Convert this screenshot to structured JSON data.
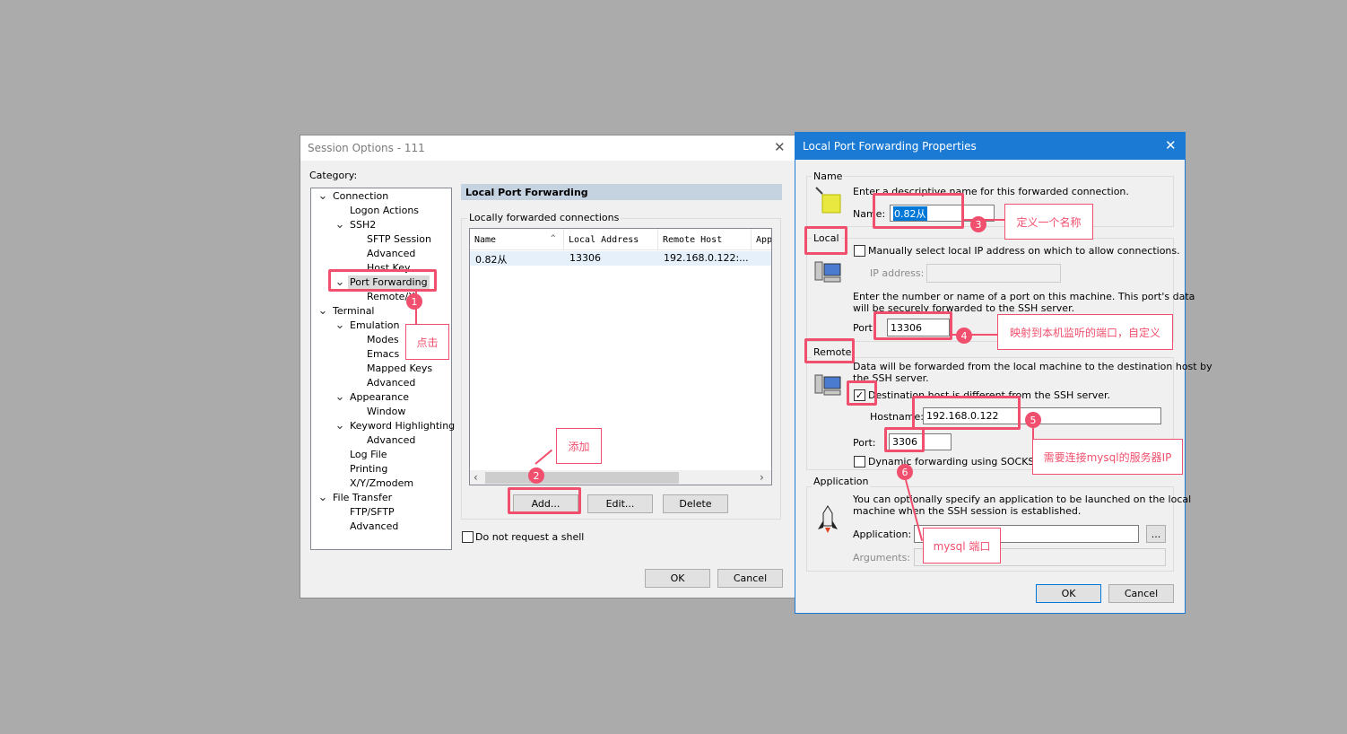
{
  "session": {
    "title": "Session Options - 111",
    "category_label": "Category:",
    "tree": [
      {
        "label": "Connection",
        "expanded": true
      },
      {
        "label": "Logon Actions"
      },
      {
        "label": "SSH2",
        "expanded": true
      },
      {
        "label": "SFTP Session"
      },
      {
        "label": "Advanced"
      },
      {
        "label": "Host Key"
      },
      {
        "label": "Port Forwarding",
        "expanded": true,
        "selected": true
      },
      {
        "label": "Remote/X"
      },
      {
        "label": "Terminal",
        "expanded": true
      },
      {
        "label": "Emulation",
        "expanded": true
      },
      {
        "label": "Modes"
      },
      {
        "label": "Emacs"
      },
      {
        "label": "Mapped Keys"
      },
      {
        "label": "Advanced"
      },
      {
        "label": "Appearance",
        "expanded": true
      },
      {
        "label": "Window"
      },
      {
        "label": "Keyword Highlighting",
        "expanded": true
      },
      {
        "label": "Advanced"
      },
      {
        "label": "Log File"
      },
      {
        "label": "Printing"
      },
      {
        "label": "X/Y/Zmodem"
      },
      {
        "label": "File Transfer",
        "expanded": true
      },
      {
        "label": "FTP/SFTP"
      },
      {
        "label": "Advanced"
      }
    ],
    "panel_header": "Local Port Forwarding",
    "group_label": "Locally forwarded connections",
    "columns": [
      "Name",
      "Local Address",
      "Remote Host",
      "App"
    ],
    "rows": [
      {
        "name": "0.82从",
        "local": "13306",
        "remote": "192.168.0.122:..."
      }
    ],
    "add_label": "Add...",
    "edit_label": "Edit...",
    "delete_label": "Delete",
    "no_shell_label": "Do not request a shell",
    "ok_label": "OK",
    "cancel_label": "Cancel"
  },
  "props": {
    "title": "Local Port Forwarding Properties",
    "name_group": "Name",
    "name_desc": "Enter a descriptive name for this forwarded connection.",
    "name_label": "Name:",
    "name_value": "0.82从",
    "local_group": "Local",
    "manual_ip_label": "Manually select local IP address on which to allow connections.",
    "ip_label": "IP address:",
    "local_desc1": "Enter the number or name of a port on this machine.  This port's data",
    "local_desc2": "will be securely forwarded to the SSH server.",
    "port_label": "Port:",
    "local_port": "13306",
    "remote_group": "Remote",
    "remote_desc1": "Data will be forwarded from the local machine to the destination host by",
    "remote_desc2": "the SSH server.",
    "dest_label": "Destination host is different from the SSH server.",
    "hostname_label": "Hostname:",
    "hostname": "192.168.0.122",
    "remote_port": "3306",
    "dynamic_label": "Dynamic forwarding using SOCKS 4 or 5",
    "app_group": "Application",
    "app_desc1": "You can optionally specify an application to be launched on the local",
    "app_desc2": "machine when the SSH session is established.",
    "app_label": "Application:",
    "browse_label": "...",
    "args_label": "Arguments:",
    "ok_label": "OK",
    "cancel_label": "Cancel"
  },
  "annotations": {
    "n1": "1",
    "t1": "点击",
    "n2": "2",
    "t2": "添加",
    "n3": "3",
    "t3": "定义一个名称",
    "n4": "4",
    "t4": "映射到本机监听的端口，自定义",
    "n5": "5",
    "t5": "需要连接mysql的服务器IP",
    "n6": "6",
    "t6": "mysql 端口",
    "color": "#f0506e"
  }
}
